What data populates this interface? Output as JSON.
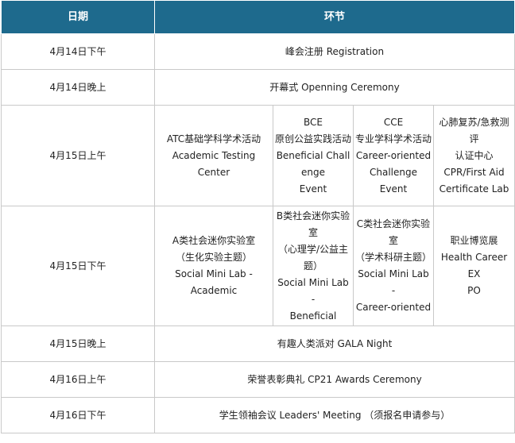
{
  "header": {
    "date": "日期",
    "session": "环节"
  },
  "rows": [
    {
      "date": "4月14日下午",
      "event": "峰会注册 Registration"
    },
    {
      "date": "4月14日晚上",
      "event": "开幕式 Openning Ceremony"
    },
    {
      "date": "4月15日上午",
      "cells": [
        [
          "ATC基础学科学术活动",
          "Academic Testing",
          "Center"
        ],
        [
          "BCE",
          "原创公益实践活动",
          "Beneficial Chall",
          "enge",
          "Event"
        ],
        [
          "CCE",
          "专业学科学术活动",
          "Career-oriented",
          "Challenge Event"
        ],
        [
          "心肺复苏/急救测",
          "评",
          "认证中心",
          "CPR/First Aid",
          "Certificate Lab"
        ]
      ]
    },
    {
      "date": "4月15日下午",
      "cells": [
        [
          "A类社会迷你实验室",
          "（生化实验主题）",
          "Social Mini Lab -",
          "Academic"
        ],
        [
          "B类社会迷你实验",
          "室",
          "（心理学/公益主",
          "题）",
          "Social Mini Lab -",
          "Beneficial"
        ],
        [
          "C类社会迷你实验",
          "室",
          "（学术科研主题）",
          "Social Mini Lab -",
          "Career-oriented"
        ],
        [
          "职业博览展",
          "Health Career EX",
          "PO"
        ]
      ]
    },
    {
      "date": "4月15日晚上",
      "event": "有趣人类派对 GALA Night"
    },
    {
      "date": "4月16日上午",
      "event": "荣誉表彰典礼 CP21 Awards Ceremony"
    },
    {
      "date": "4月16日下午",
      "event": "学生领袖会议 Leaders' Meeting （须报名申请参与）"
    }
  ],
  "colors": {
    "header_bg": "#1e6a8d",
    "date_text": "#c0282d",
    "border": "#c9c9c9"
  }
}
